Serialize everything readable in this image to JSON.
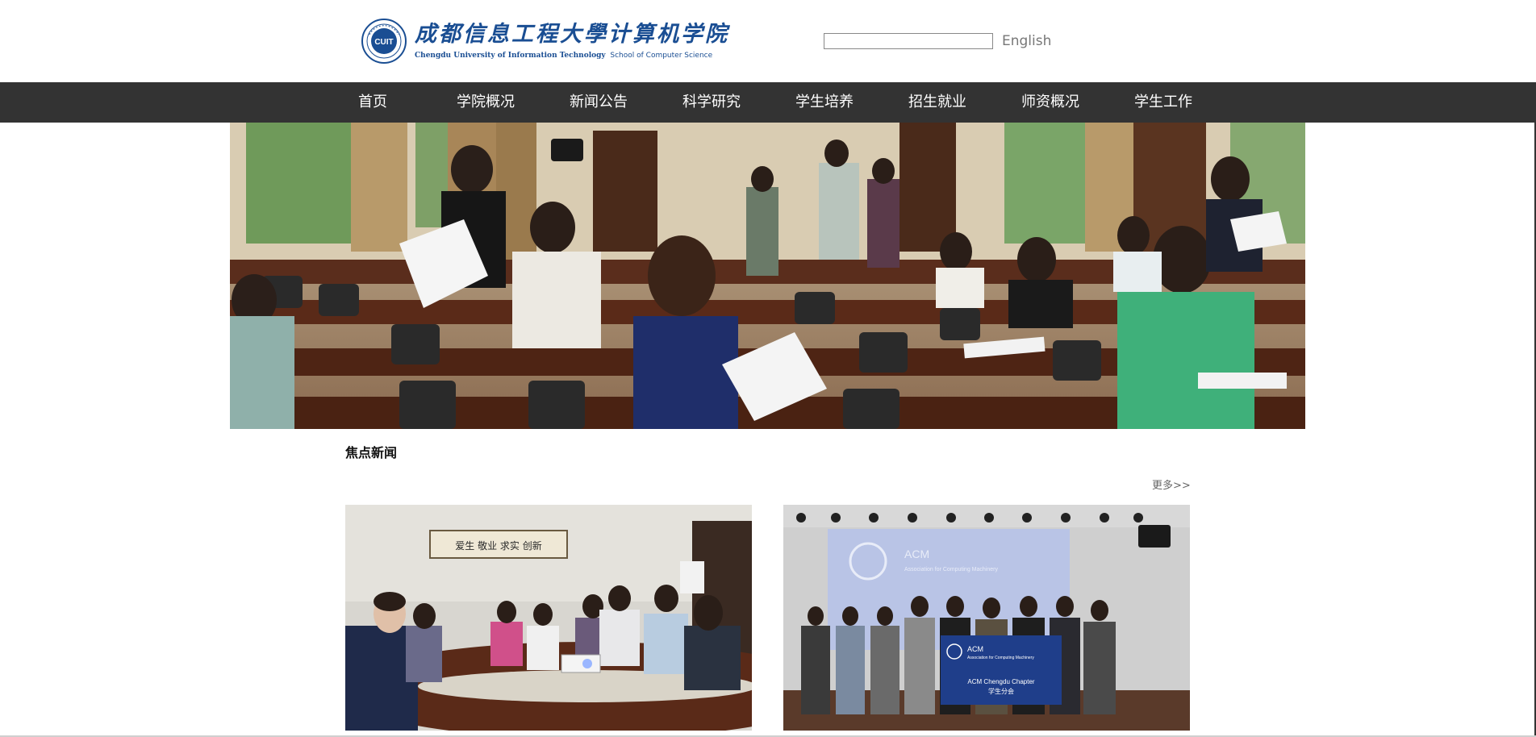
{
  "header": {
    "logo": {
      "name_cn": "成都信息工程大學计算机学院",
      "university_en": "Chengdu University of Information Technology",
      "school_en": "School of Computer Science",
      "seal_text": "CUIT"
    },
    "search": {
      "value": "",
      "placeholder": ""
    },
    "language_link": "English"
  },
  "nav": {
    "items": [
      {
        "label": "首页"
      },
      {
        "label": "学院概况"
      },
      {
        "label": "新闻公告"
      },
      {
        "label": "科学研究"
      },
      {
        "label": "学生培养"
      },
      {
        "label": "招生就业"
      },
      {
        "label": "师资概况"
      },
      {
        "label": "学生工作"
      }
    ]
  },
  "focus_news": {
    "title": "焦点新闻",
    "more": "更多>>",
    "photos": [
      {
        "kind": "meeting-photo",
        "wall_plaque": "爱生 敬业 求实 创新"
      },
      {
        "kind": "group-photo",
        "screen_text": "ACM",
        "screen_subtext": "Association for Computing Machinery",
        "banner_title": "ACM",
        "banner_subtitle": "Association for Computing Machinery",
        "banner_line1": "ACM Chengdu Chapter",
        "banner_line2": "学生分会"
      }
    ]
  },
  "colors": {
    "nav_background": "#333333",
    "logo_blue": "#1a4e93",
    "text_gray": "#777777"
  }
}
